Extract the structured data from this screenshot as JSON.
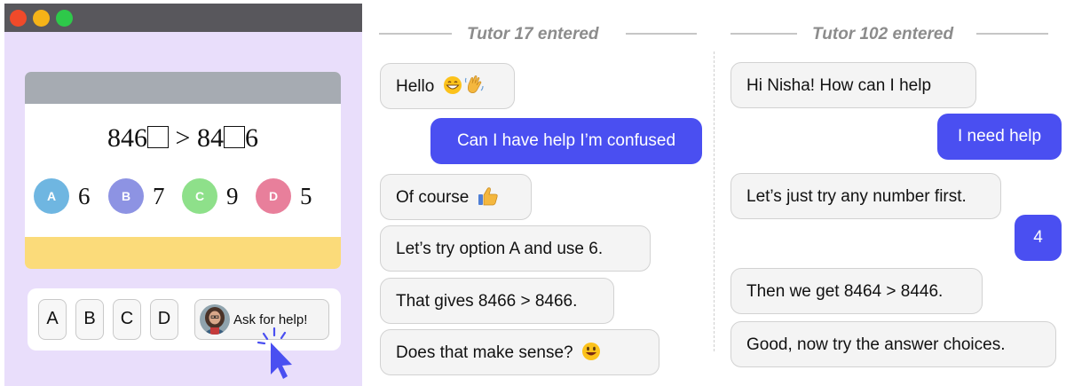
{
  "window": {
    "controls": [
      "close",
      "minimize",
      "maximize"
    ]
  },
  "problem": {
    "left_number": "846",
    "comparator": ">",
    "right_prefix": "84",
    "right_suffix": "6",
    "choices": [
      {
        "letter": "A",
        "value": "6",
        "color": "#6fb6e1"
      },
      {
        "letter": "B",
        "value": "7",
        "color": "#8d93e3"
      },
      {
        "letter": "C",
        "value": "9",
        "color": "#8ee08a"
      },
      {
        "letter": "D",
        "value": "5",
        "color": "#e87f9b"
      }
    ]
  },
  "answer_bar": {
    "buttons": [
      "A",
      "B",
      "C",
      "D"
    ],
    "help_label": "Ask for help!"
  },
  "chats": [
    {
      "header": "Tutor 17 entered",
      "messages": [
        {
          "from": "tutor",
          "text": "Hello",
          "emoji": [
            "grinning-face-icon",
            "waving-hand-icon"
          ]
        },
        {
          "from": "student",
          "text": "Can I have help I’m confused"
        },
        {
          "from": "tutor",
          "text": "Of course",
          "emoji": [
            "thumbs-up-icon"
          ]
        },
        {
          "from": "tutor",
          "text": "Let’s try option A and use 6."
        },
        {
          "from": "tutor",
          "text": "That gives 8466 > 8466."
        },
        {
          "from": "tutor",
          "text": "Does that make sense?",
          "emoji": [
            "smiley-face-icon"
          ]
        }
      ]
    },
    {
      "header": "Tutor 102 entered",
      "messages": [
        {
          "from": "tutor",
          "text": "Hi Nisha! How can I help"
        },
        {
          "from": "student",
          "text": "I need help"
        },
        {
          "from": "tutor",
          "text": "Let’s just try any number first."
        },
        {
          "from": "student",
          "text": "4"
        },
        {
          "from": "tutor",
          "text": "Then we get 8464 > 8446."
        },
        {
          "from": "tutor",
          "text": "Good, now try the answer choices."
        }
      ]
    }
  ],
  "colors": {
    "student_bubble": "#4a4ff1",
    "tutor_bubble": "#f4f4f4",
    "window_background": "#e9defb",
    "card_header": "#a6abb2",
    "card_footer": "#fbdb7a"
  }
}
